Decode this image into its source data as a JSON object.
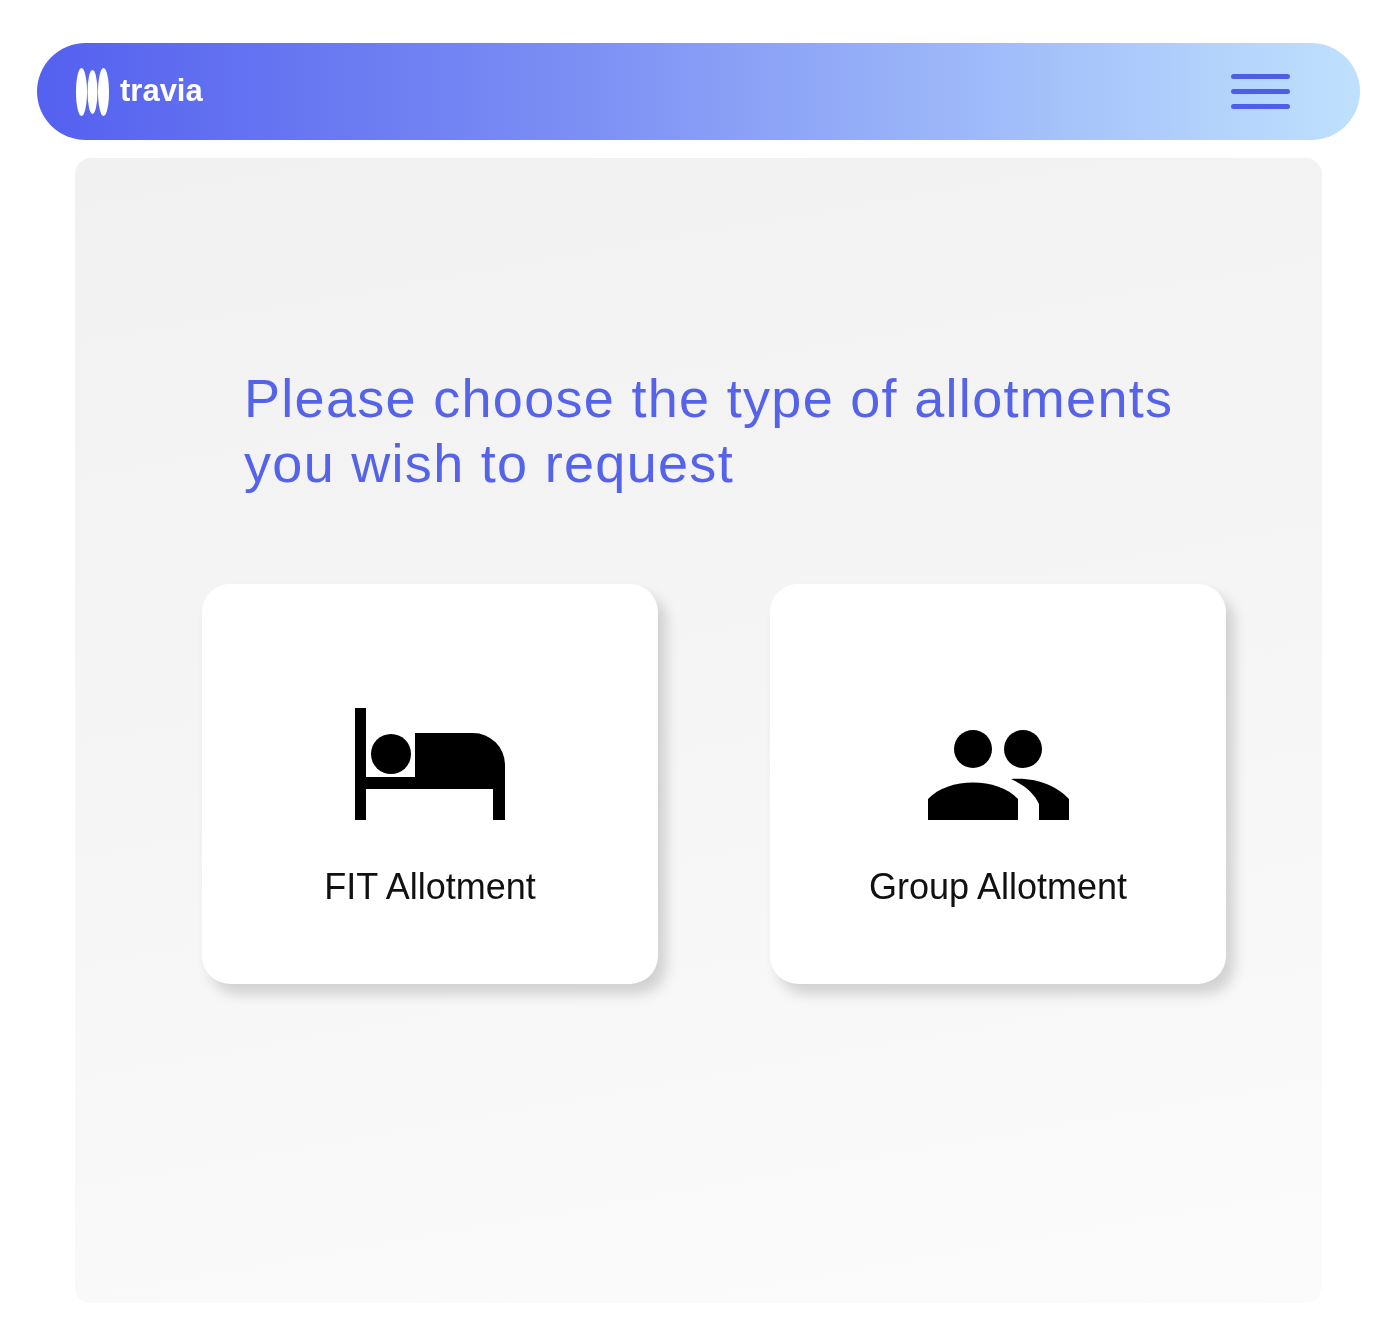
{
  "header": {
    "brand": "travia"
  },
  "heading": "Please choose the type of allotments you wish to request",
  "options": [
    {
      "kind": "bed",
      "label": "FIT Allotment"
    },
    {
      "kind": "group",
      "label": "Group Allotment"
    }
  ]
}
